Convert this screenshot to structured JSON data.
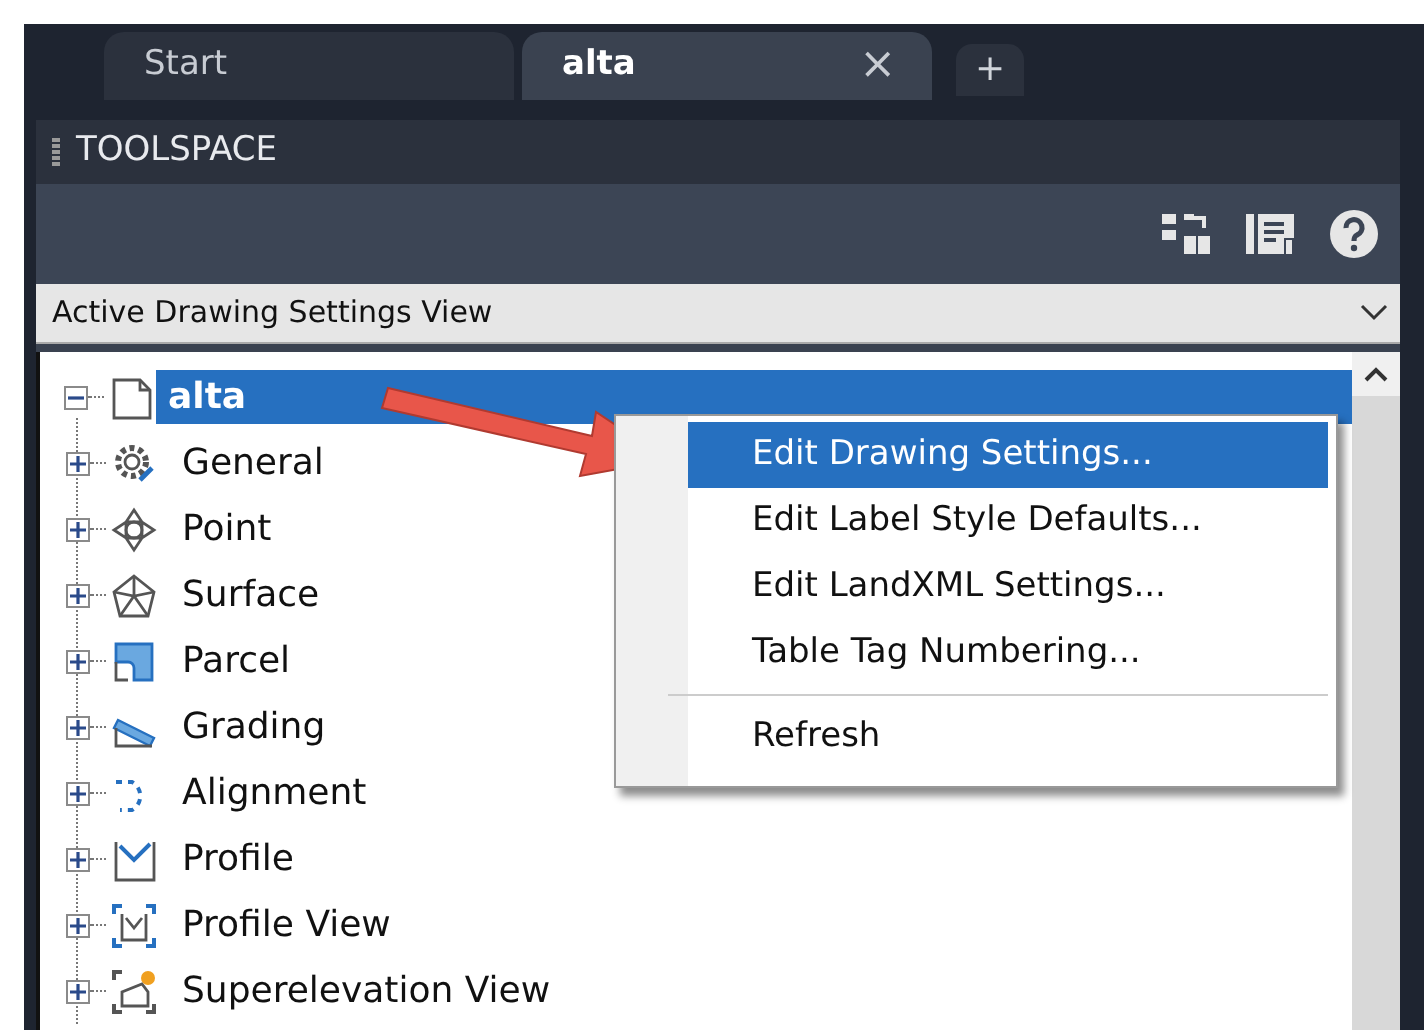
{
  "tabs": [
    {
      "label": "Start",
      "selected": false
    },
    {
      "label": "alta",
      "selected": true,
      "close": "×"
    }
  ],
  "new_tab": "+",
  "panel": {
    "title": "TOOLSPACE"
  },
  "view_select": {
    "value": "Active Drawing Settings View"
  },
  "tree": [
    {
      "label": "alta",
      "kind": "drawing",
      "selected": true,
      "expanded": true,
      "children": [
        {
          "label": "General",
          "kind": "gear",
          "selected": false,
          "expanded": false
        },
        {
          "label": "Point",
          "kind": "point",
          "selected": false,
          "expanded": false
        },
        {
          "label": "Surface",
          "kind": "surface",
          "selected": false,
          "expanded": false
        },
        {
          "label": "Parcel",
          "kind": "parcel",
          "selected": false,
          "expanded": false
        },
        {
          "label": "Grading",
          "kind": "grading",
          "selected": false,
          "expanded": false
        },
        {
          "label": "Alignment",
          "kind": "alignment",
          "selected": false,
          "expanded": false
        },
        {
          "label": "Profile",
          "kind": "profile",
          "selected": false,
          "expanded": false
        },
        {
          "label": "Profile View",
          "kind": "profileview",
          "selected": false,
          "expanded": false
        },
        {
          "label": "Superelevation View",
          "kind": "superelevation",
          "selected": false,
          "expanded": false
        }
      ]
    }
  ],
  "context_menu": [
    {
      "kind": "item",
      "label": "Edit Drawing Settings...",
      "selected": true
    },
    {
      "kind": "item",
      "label": "Edit Label Style Defaults...",
      "selected": false
    },
    {
      "kind": "item",
      "label": "Edit LandXML Settings...",
      "selected": false
    },
    {
      "kind": "item",
      "label": "Table Tag Numbering...",
      "selected": false
    },
    {
      "kind": "separator"
    },
    {
      "kind": "item",
      "label": "Refresh",
      "selected": false
    }
  ]
}
